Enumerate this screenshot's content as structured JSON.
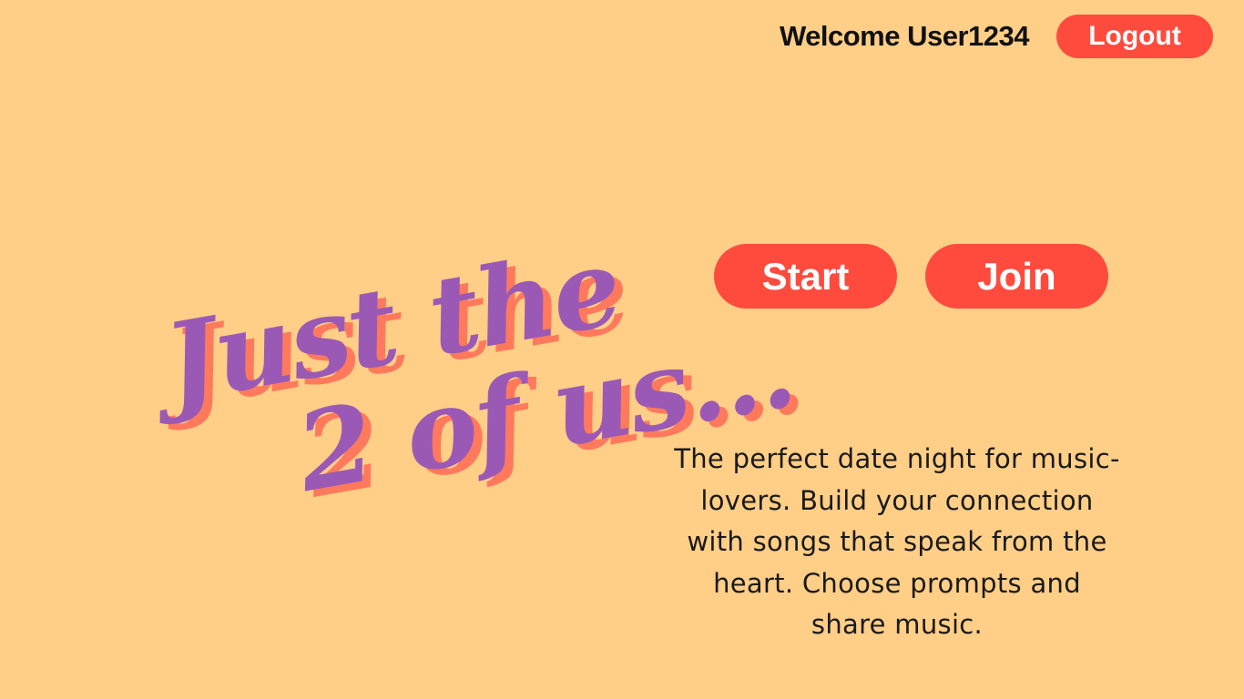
{
  "header": {
    "welcome_text": "Welcome User1234",
    "logout_label": "Logout"
  },
  "hero": {
    "title_line1": "Just the",
    "title_line2": "2 of us...",
    "title_color": "#9b59b6",
    "title_shadow_color": "#ff7a5c"
  },
  "actions": {
    "start_label": "Start",
    "join_label": "Join"
  },
  "description": "The perfect date night for music-lovers. Build your connection with songs that speak from the heart. Choose prompts and share music.",
  "colors": {
    "background": "#ffce87",
    "accent": "#ff4b3e",
    "text": "#111111"
  }
}
